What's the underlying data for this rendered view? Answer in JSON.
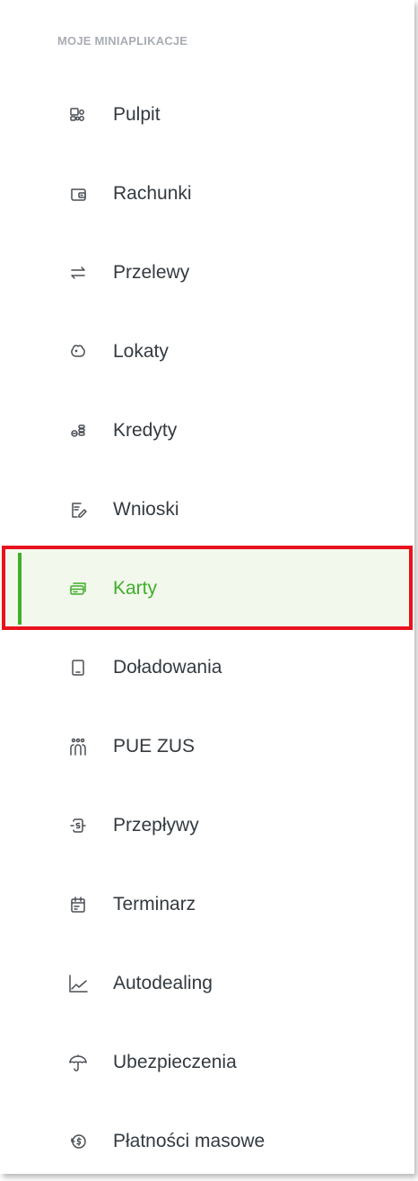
{
  "section_title": "MOJE MINIAPLIKACJE",
  "colors": {
    "accent": "#3fae2a",
    "active_bg": "#f2f8ec",
    "highlight": "#e8121f"
  },
  "menu": {
    "items": [
      {
        "label": "Pulpit",
        "icon": "dashboard-icon",
        "active": false
      },
      {
        "label": "Rachunki",
        "icon": "wallet-icon",
        "active": false
      },
      {
        "label": "Przelewy",
        "icon": "transfer-arrows-icon",
        "active": false
      },
      {
        "label": "Lokaty",
        "icon": "piggy-bank-icon",
        "active": false
      },
      {
        "label": "Kredyty",
        "icon": "coins-icon",
        "active": false
      },
      {
        "label": "Wnioski",
        "icon": "form-edit-icon",
        "active": false
      },
      {
        "label": "Karty",
        "icon": "cards-icon",
        "active": true
      },
      {
        "label": "Doładowania",
        "icon": "phone-icon",
        "active": false
      },
      {
        "label": "PUE ZUS",
        "icon": "people-icon",
        "active": false
      },
      {
        "label": "Przepływy",
        "icon": "cashflow-icon",
        "active": false
      },
      {
        "label": "Terminarz",
        "icon": "calendar-icon",
        "active": false
      },
      {
        "label": "Autodealing",
        "icon": "line-chart-icon",
        "active": false
      },
      {
        "label": "Ubezpieczenia",
        "icon": "umbrella-icon",
        "active": false
      },
      {
        "label": "Płatności masowe",
        "icon": "money-cycle-icon",
        "active": false
      }
    ]
  }
}
